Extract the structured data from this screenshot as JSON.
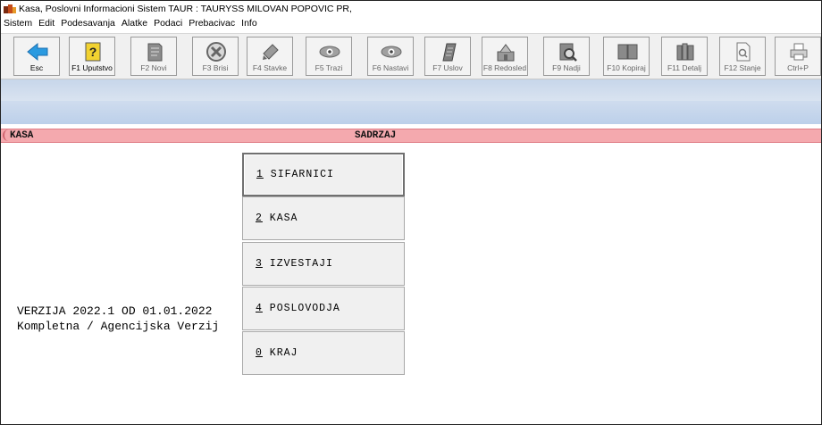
{
  "title": "Kasa, Poslovni Informacioni Sistem TAUR : TAURYSS MILOVAN POPOVIC PR,",
  "menu": [
    "Sistem",
    "Edit",
    "Podesavanja",
    "Alatke",
    "Podaci",
    "Prebacivac",
    "Info"
  ],
  "toolbar": {
    "esc": "Esc",
    "f1": "F1 Uputstvo",
    "f2": "F2 Novi",
    "f3": "F3 Brisi",
    "f4": "F4 Stavke",
    "f5": "F5 Trazi",
    "f6": "F6 Nastavi",
    "f7": "F7 Uslov",
    "f8": "F8 Redosled",
    "f9": "F9 Nadji",
    "f10": "F10 Kopiraj",
    "f11": "F11 Detalj",
    "f12": "F12 Stanje",
    "ctrlp": "Ctrl+P"
  },
  "header": {
    "left": "KASA",
    "center": "SADRZAJ"
  },
  "version": {
    "line1": "VERZIJA 2022.1 OD 01.01.2022",
    "line2": "Kompletna / Agencijska Verzij"
  },
  "main_menu": [
    {
      "key": "1",
      "label": " SIFARNICI"
    },
    {
      "key": "2",
      "label": " KASA"
    },
    {
      "key": "3",
      "label": " IZVESTAJI"
    },
    {
      "key": "4",
      "label": " POSLOVODJA"
    },
    {
      "key": "0",
      "label": " KRAJ"
    }
  ],
  "colors": {
    "header_bar": "#f4a9ae",
    "esc_arrow": "#2a9ae0",
    "help_icon": "#f2d230"
  }
}
